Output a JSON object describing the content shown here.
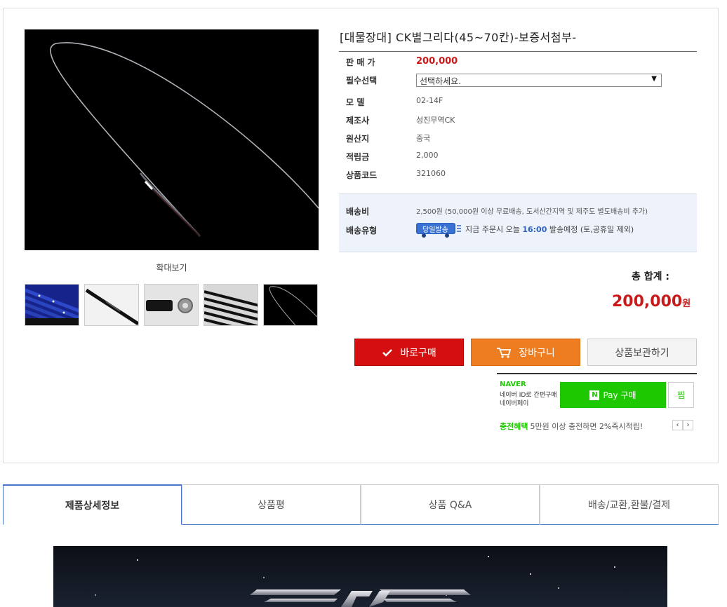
{
  "product": {
    "title": "[대물장대] CK별그리다(45~70칸)-보증서첨부-",
    "zoom_label": "확대보기"
  },
  "info": {
    "price_label": "판 매 가",
    "price_value": "200,000",
    "option_label": "필수선택",
    "option_selected": "선택하세요.",
    "model_label": "모 델",
    "model_value": "02-14F",
    "maker_label": "제조사",
    "maker_value": "성진무역CK",
    "origin_label": "원산지",
    "origin_value": "중국",
    "points_label": "적립금",
    "points_value": "2,000",
    "code_label": "상품코드",
    "code_value": "321060"
  },
  "shipping": {
    "fee_label": "배송비",
    "fee_value": "2,500원 (50,000원 이상 무료배송, 도서산간지역 및 제주도 별도배송비 추가)",
    "type_label": "배송유형",
    "badge_text": "당일발송",
    "type_prefix": "지금 주문시 오늘",
    "type_time": "16:00",
    "type_suffix": "발송예정 (토,공휴일 제외)"
  },
  "total": {
    "label": "총 합계 :",
    "price": "200,000",
    "unit": "원"
  },
  "buttons": {
    "buy": "바로구매",
    "cart": "장바구니",
    "wish": "상품보관하기"
  },
  "npay": {
    "naver": "NAVER",
    "desc_line1": "네이버 ID로 간편구매",
    "desc_line2": "네이버페이",
    "pay_label": "Pay 구매",
    "n_mark": "N",
    "jjim": "찜",
    "charge_label": "충전혜택",
    "charge_text": "5만원 이상 충전하면 2%즉시적립!",
    "prev": "‹",
    "next": "›"
  },
  "tabs": [
    "제품상세정보",
    "상품평",
    "상품 Q&A",
    "배송/교환,환불/결제"
  ],
  "colors": {
    "price_red": "#c81a1a",
    "buy_red": "#d50f0f",
    "cart_orange": "#ee7d21",
    "naver_green": "#1ec800",
    "tab_blue": "#4a74c7"
  }
}
